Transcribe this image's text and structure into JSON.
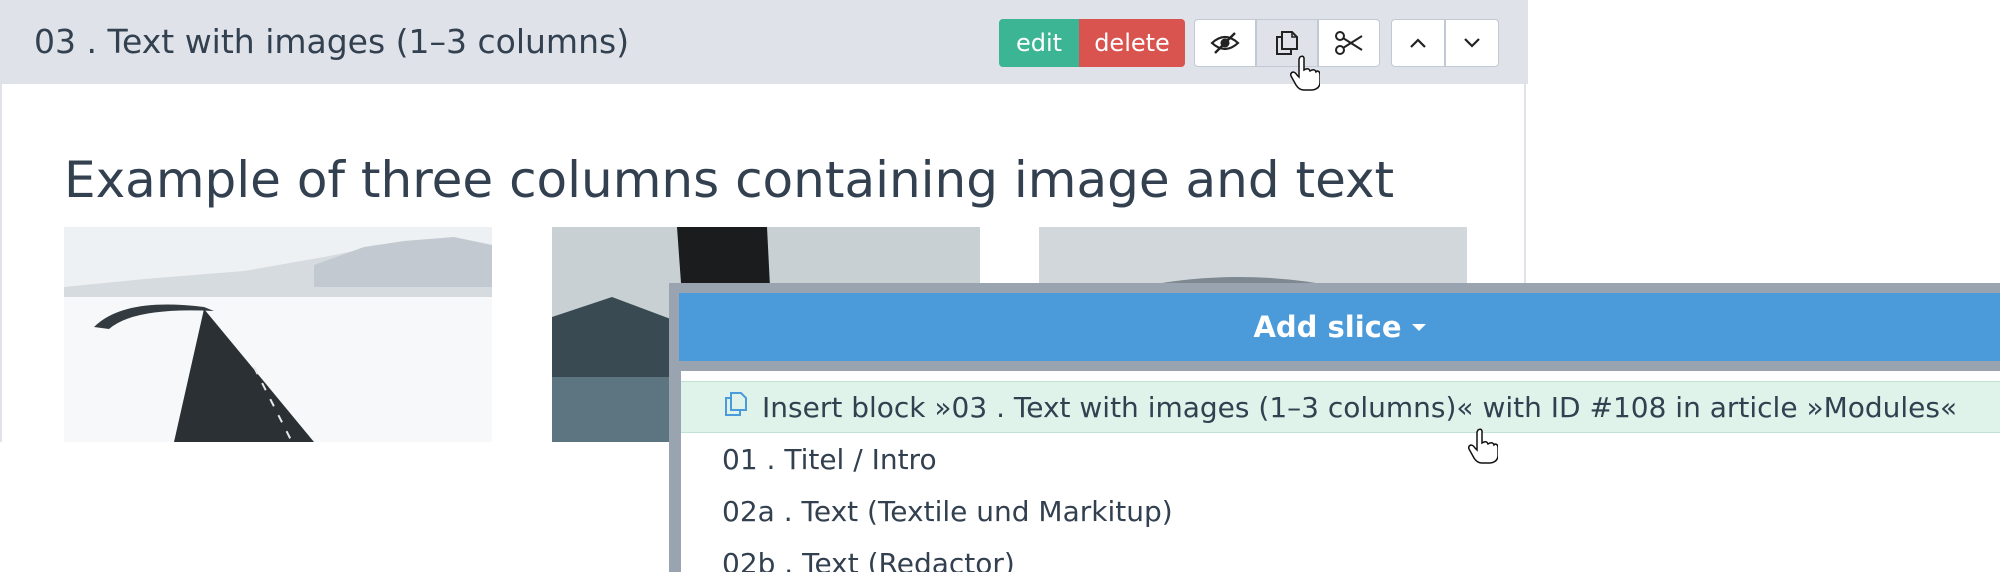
{
  "slice": {
    "title": "03 . Text with images (1–3 columns)",
    "edit_label": "edit",
    "delete_label": "delete",
    "content_heading": "Example of three columns containing image and text"
  },
  "add_slice": {
    "toggle_label": "Add slice",
    "items": [
      {
        "label": "Insert block »03 . Text with images (1–3 columns)« with ID #108 in article »Modules«"
      },
      {
        "label": "01 . Titel / Intro"
      },
      {
        "label": "02a . Text (Textile und Markitup)"
      },
      {
        "label": "02b . Text (Redactor)"
      }
    ]
  },
  "colors": {
    "edit": "#3bb594",
    "delete": "#d9534f",
    "add_slice": "#4b9ad9",
    "highlight": "#dff3ea",
    "header_bg": "#dfe3e9"
  },
  "icons": [
    "eye-slash-icon",
    "copy-icon",
    "scissors-icon",
    "chevron-up-icon",
    "chevron-down-icon",
    "hand-pointer-icon"
  ]
}
